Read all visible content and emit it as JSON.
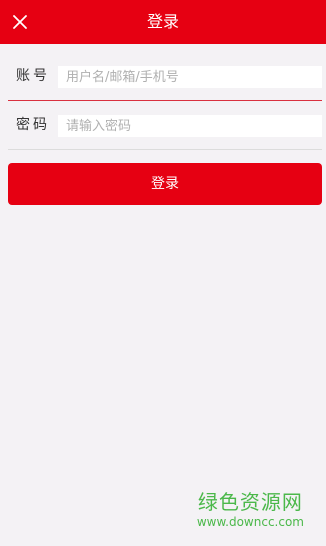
{
  "header": {
    "title": "登录",
    "close_icon": "close-icon",
    "color": "#e60012"
  },
  "form": {
    "account": {
      "label": "账号",
      "value": "",
      "placeholder": "用户名/邮箱/手机号"
    },
    "password": {
      "label": "密码",
      "value": "",
      "placeholder": "请输入密码"
    }
  },
  "actions": {
    "login_label": "登录"
  },
  "watermark": {
    "title": "绿色资源网",
    "url": "www.downcc.com"
  }
}
